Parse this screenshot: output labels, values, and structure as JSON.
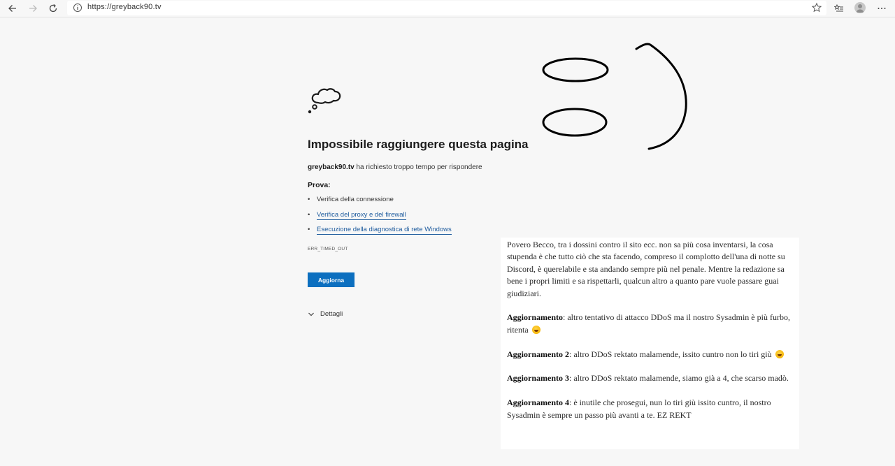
{
  "browser": {
    "url": "https://greyback90.tv"
  },
  "error": {
    "title": "Impossibile raggiungere questa pagina",
    "host": "greyback90.tv",
    "description_suffix": " ha richiesto troppo tempo per rispondere",
    "try_label": "Prova:",
    "suggestions": [
      "Verifica della connessione",
      "Verifica del proxy e del firewall",
      "Esecuzione della diagnostica di rete Windows"
    ],
    "code": "ERR_TIMED_OUT",
    "reload_label": "Aggiorna",
    "details_label": "Dettagli"
  },
  "article": {
    "intro": "Povero Becco, tra i dossini contro il sito ecc. non sa più cosa inventarsi, la cosa stupenda è che tutto ciò che sta facendo, compreso il complotto dell'una di notte su Discord, è querelabile e sta andando sempre più nel penale. Mentre la redazione sa bene i propri limiti e sa rispettarli, qualcun altro a quanto pare vuole passare guai giudiziari.",
    "updates": [
      {
        "label": "Aggiornamento",
        "text": ": altro tentativo di attacco DDoS ma il nostro Sysadmin è più furbo, ritenta ",
        "emoji": "rolling-on-floor-laughing"
      },
      {
        "label": "Aggiornamento 2",
        "text": ": altro DDoS rektato malamende, issito cuntro non lo tiri giù ",
        "emoji": "rolling-on-floor-laughing"
      },
      {
        "label": "Aggiornamento 3",
        "text": ": altro DDoS rektato malamende, siamo già a 4, che scarso madò.",
        "emoji": ""
      },
      {
        "label": "Aggiornamento 4",
        "text": ": è inutile che prosegui, nun lo tiri giù issito cuntro, il nostro Sysadmin è sempre un passo più avanti a te. EZ REKT",
        "emoji": ""
      }
    ]
  },
  "colors": {
    "page_bg": "#f7f7f7",
    "button_bg": "#0c6fbf",
    "link": "#1f5c9e"
  },
  "icons": {
    "toolbar": [
      "back-arrow-icon",
      "forward-arrow-icon",
      "refresh-icon",
      "site-info-icon",
      "favorite-star-icon",
      "favorites-list-icon",
      "profile-avatar",
      "more-menu-icon"
    ],
    "error": "thought-cloud-icon",
    "details": "chevron-down-icon"
  }
}
